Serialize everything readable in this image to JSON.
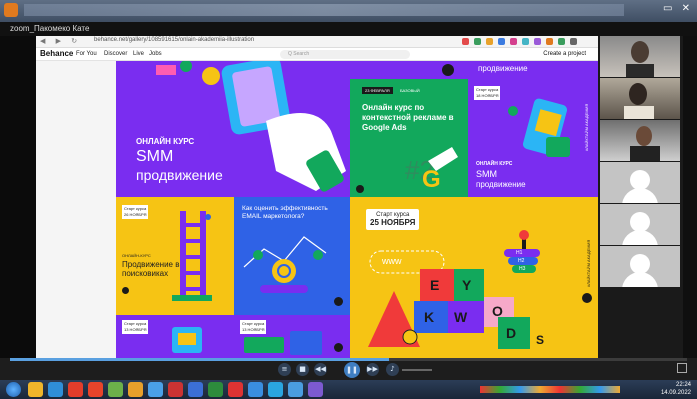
{
  "window": {
    "title": "zoom_Пакомеко Кате"
  },
  "browser": {
    "url": "behance.net/gallery/108591615/onlain-akademiia-illustration",
    "logo": "Behance",
    "nav": [
      "For You",
      "Discover",
      "Live",
      "Jobs"
    ],
    "search_placeholder": "Q Search",
    "create": "Create a project"
  },
  "gallery": {
    "tile_smm": {
      "line1": "ОНЛАЙН КУРС",
      "line2": "SMM",
      "line3": "продвижение"
    },
    "tile_google": {
      "date": "23 ФЕВРАЛЯ",
      "tag": "БАЗОВЫЙ",
      "title": "Онлайн курс по контекстной рекламе в Google Ads"
    },
    "tile_right_top": {
      "text": "продвижение"
    },
    "tile_right_smm": {
      "date_label": "Старт курса",
      "date": "18 НОЯБРЯ",
      "line1": "ОНЛАЙН КУРС",
      "line2": "SMM",
      "line3": "продвижение",
      "vertical": "#ЛАЙКТАЙМ АКАДЕМИЯ"
    },
    "tile_seo": {
      "date_label": "Старт курса",
      "date": "26 НОЯБРЯ",
      "kicker": "ОНЛАЙН-КУРС",
      "title": "Продвижение в поисковиках"
    },
    "tile_email": {
      "title": "Как оценить эффективность EMAIL маркетолога?"
    },
    "tile_start": {
      "label": "Старт курса",
      "date": "25 НОЯБРЯ",
      "www": "www",
      "vertical": "#ЛАЙКТАЙМ АКАДЕМИЯ",
      "blocks": [
        "E",
        "Y",
        "K",
        "W",
        "O",
        "D",
        "S"
      ],
      "pyramid": [
        "H1",
        "H2",
        "H3"
      ]
    },
    "tile_bottom1": {
      "date_label": "Старт курса",
      "date": "13 НОЯБРЯ"
    },
    "tile_bottom2": {
      "date_label": "Старт курса",
      "date": "13 НОЯБРЯ"
    }
  },
  "player": {
    "progress": 0.56,
    "accent": "#5aa0e0"
  },
  "taskbar": {
    "time": "22:24",
    "date": "14.09.2022"
  },
  "colors": {
    "purple": "#7a2df0",
    "green": "#12a85c",
    "yellow": "#f6c414",
    "blue": "#2f62e6"
  }
}
